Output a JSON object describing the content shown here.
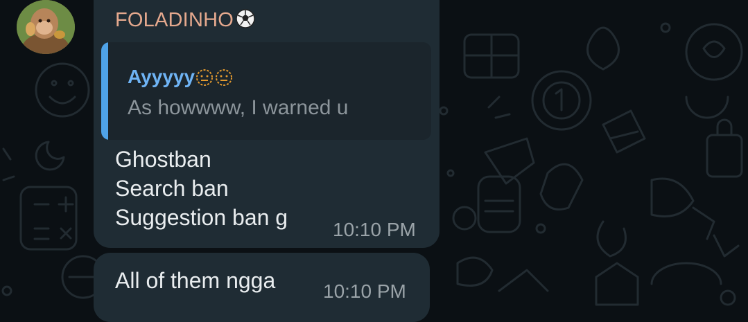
{
  "chat": {
    "sender_name": "FOLADINHO",
    "sender_badge_icon": "soccer-ball-icon",
    "accent_name_color": "#e5a98e",
    "bubble_color": "#1f2c34",
    "reply_quote": {
      "author": "Ayyyyy",
      "author_emojis": [
        "neutral-face-icon",
        "neutral-face-icon"
      ],
      "text": "As howwww, I warned u",
      "bar_color": "#4fa3e8"
    },
    "messages": [
      {
        "lines": [
          "Ghostban",
          "Search ban",
          "Suggestion ban g"
        ],
        "time": "10:10 PM"
      },
      {
        "lines": [
          "All of them ngga"
        ],
        "time": "10:10 PM"
      }
    ]
  }
}
